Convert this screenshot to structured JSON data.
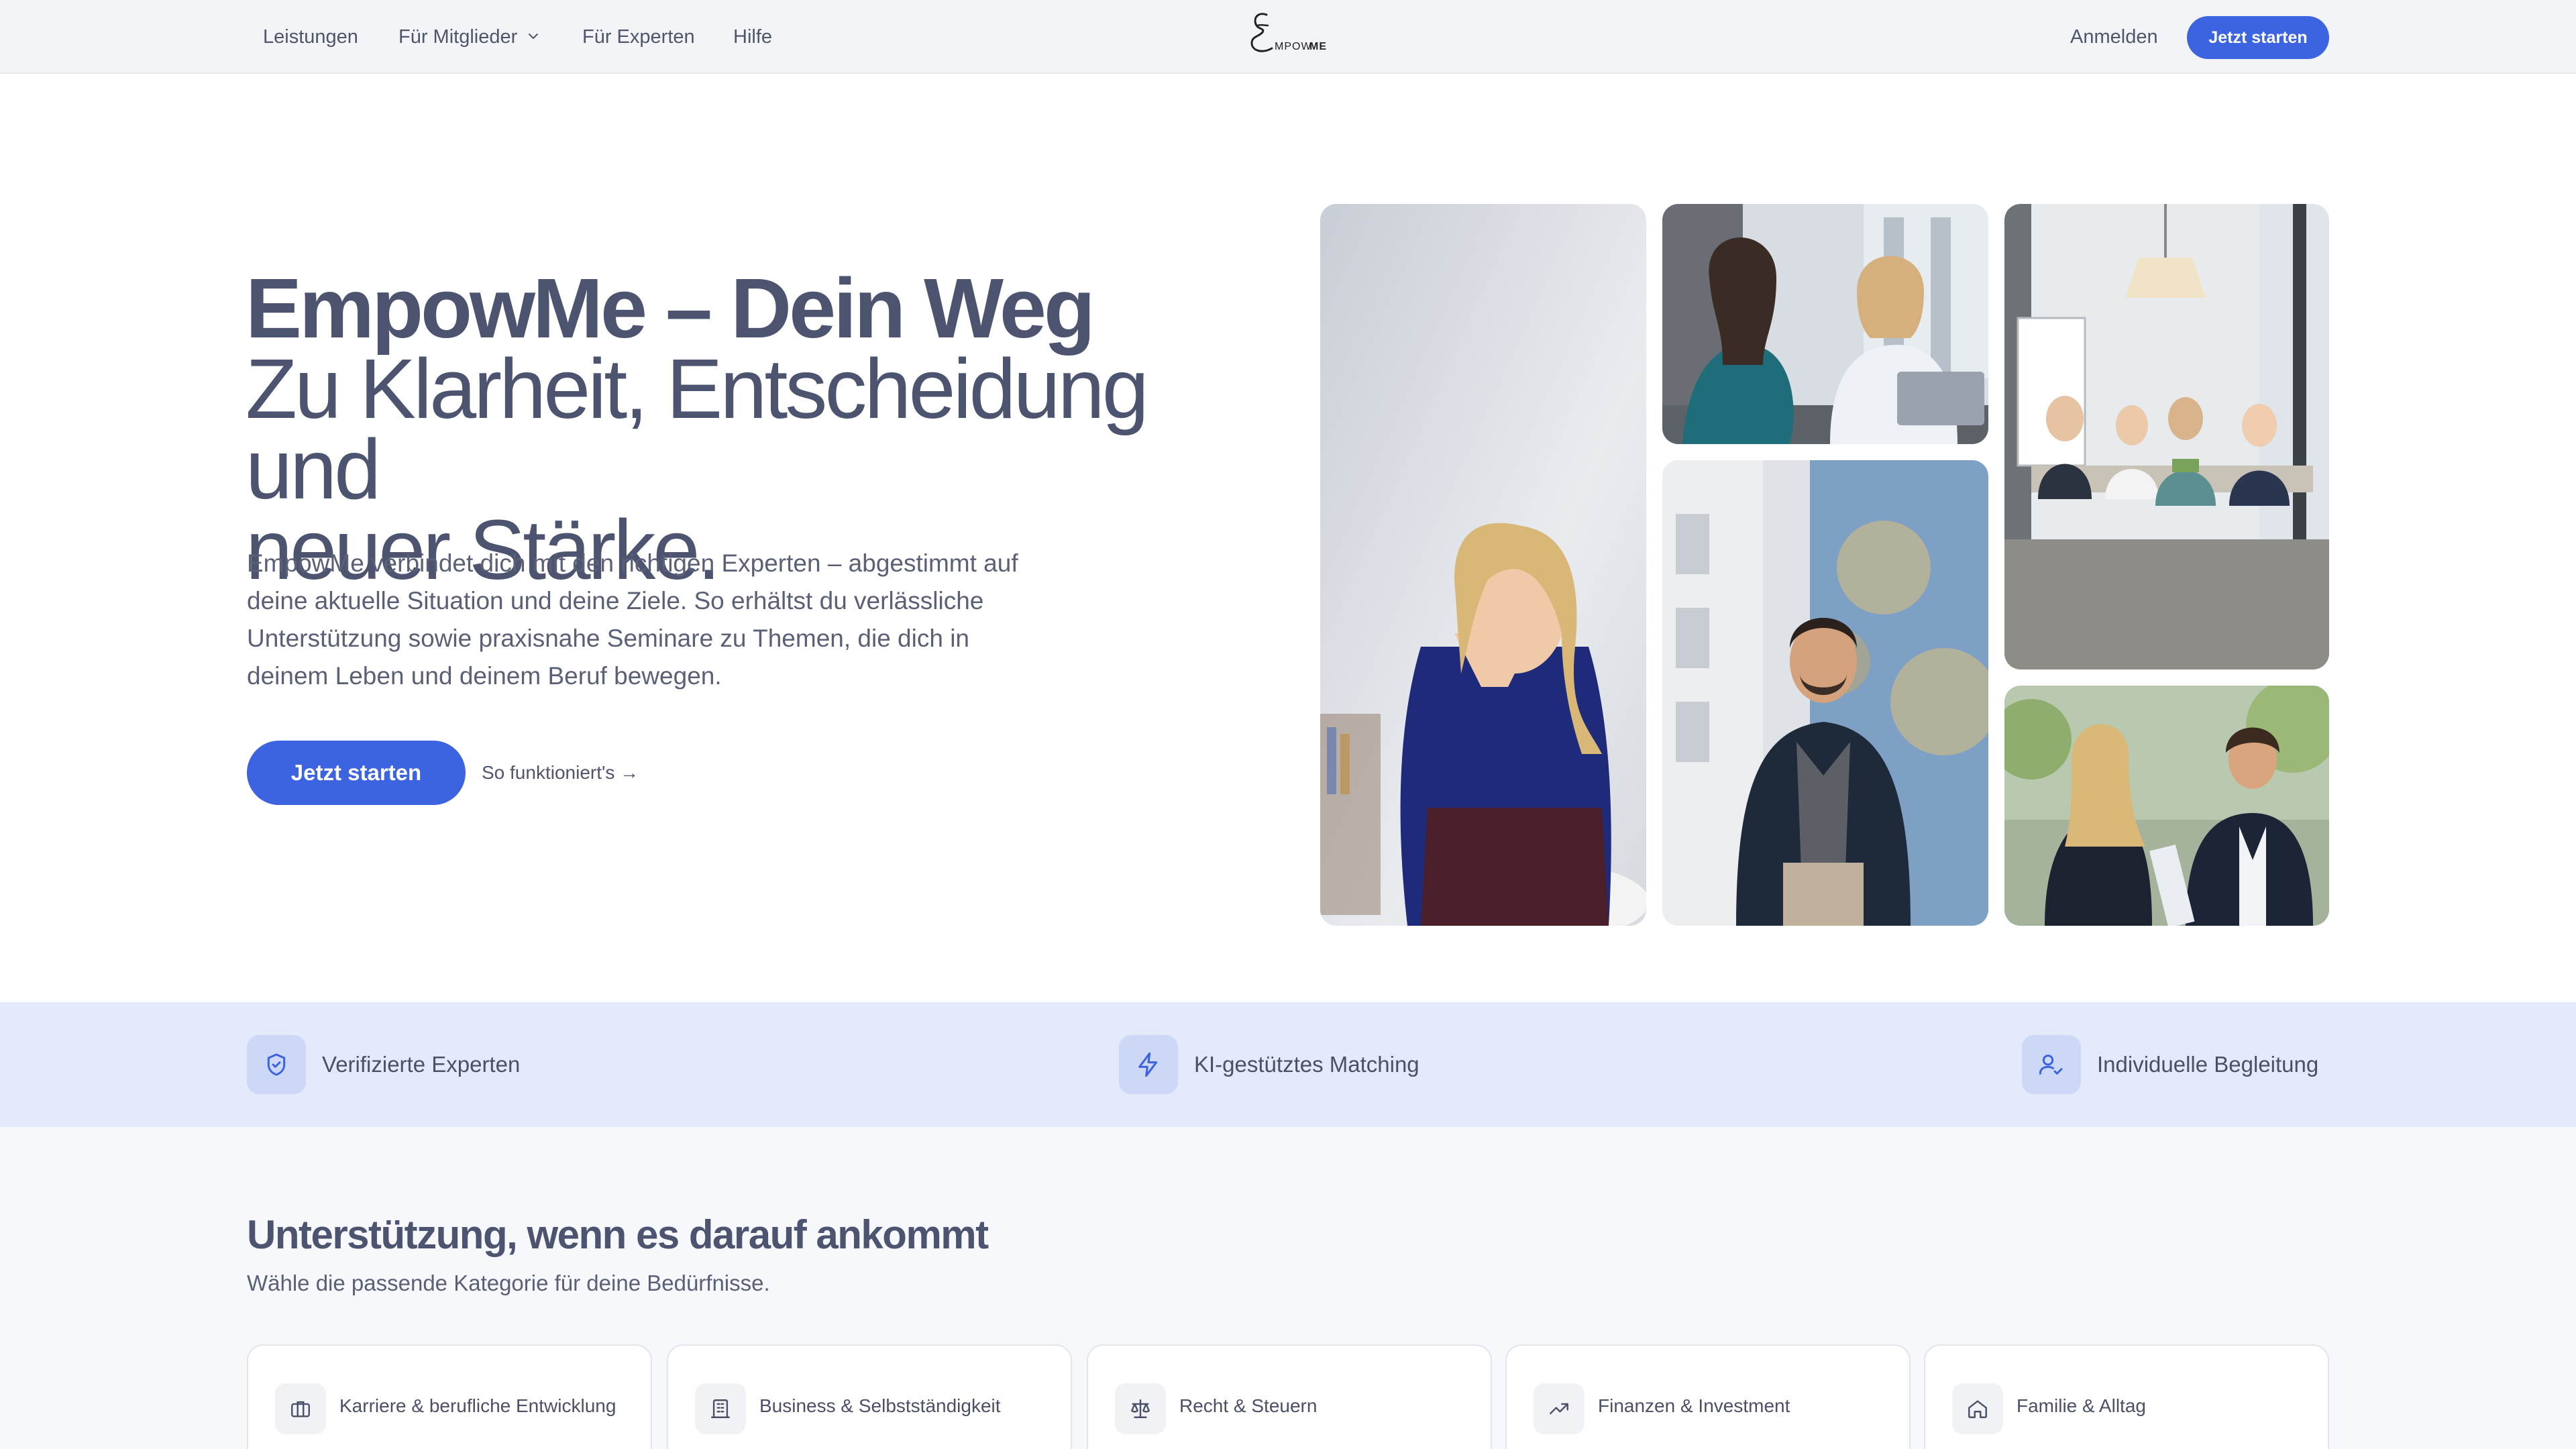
{
  "nav": {
    "links": [
      "Leistungen",
      "Für Mitglieder",
      "Für Experten",
      "Hilfe"
    ],
    "logo_text": "EmpowMe",
    "login": "Anmelden",
    "cta": "Jetzt starten"
  },
  "hero": {
    "title_line1": "EmpowMe – Dein Weg",
    "title_line2": "Zu Klarheit, Entscheidung und",
    "title_line3": "neuer Stärke.",
    "text": "EmpowMe verbindet dich mit den richtigen Experten – abgestimmt auf deine aktuelle Situation und deine Ziele. So erhältst du verlässliche Unterstützung sowie praxisnahe Seminare zu Themen, die dich in deinem Leben und deinem Beruf bewegen.",
    "cta": "Jetzt starten",
    "link": "So funktioniert's →"
  },
  "features": [
    {
      "label": "Verifizierte Experten",
      "icon": "shield-check-icon"
    },
    {
      "label": "KI-gestütztes Matching",
      "icon": "lightning-icon"
    },
    {
      "label": "Individuelle Begleitung",
      "icon": "user-check-icon"
    }
  ],
  "categories": {
    "title": "Unterstützung, wenn es darauf ankommt",
    "subtitle": "Wähle die passende Kategorie für deine Bedürfnisse.",
    "items": [
      {
        "label": "Karriere & berufliche Entwicklung",
        "icon": "briefcase-icon"
      },
      {
        "label": "Business & Selbstständigkeit",
        "icon": "building-icon"
      },
      {
        "label": "Recht & Steuern",
        "icon": "scales-icon"
      },
      {
        "label": "Finanzen & Investment",
        "icon": "trending-up-icon"
      },
      {
        "label": "Familie & Alltag",
        "icon": "home-icon"
      }
    ]
  },
  "colors": {
    "accent": "#3c63e0",
    "strip": "#e4eafa",
    "text": "#4d5470"
  }
}
